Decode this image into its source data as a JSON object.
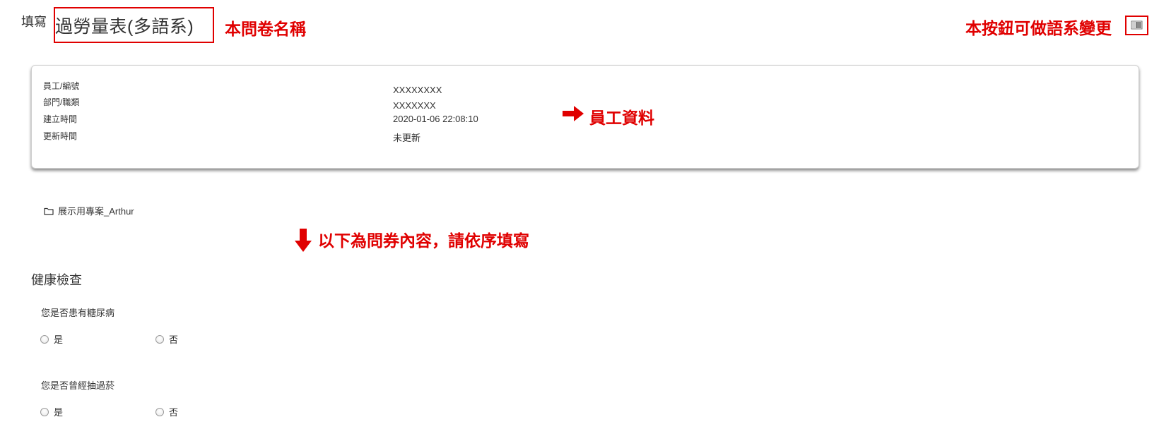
{
  "header": {
    "prefix": "填寫",
    "survey_title": "過勞量表(多語系)"
  },
  "annotations": {
    "title_note": "本問卷名稱",
    "language_note": "本按鈕可做語系變更",
    "employee_note": "員工資料",
    "content_note": "以下為問券內容，請依序填寫"
  },
  "language_button": {
    "icon": "flag-icon"
  },
  "employee": {
    "rows": [
      {
        "label": "員工/編號",
        "value": "XXXXXXXX"
      },
      {
        "label": "部門/職類",
        "value": "XXXXXXX"
      },
      {
        "label": "建立時間",
        "value": "2020-01-06 22:08:10"
      },
      {
        "label": "更新時間",
        "value": "未更新"
      }
    ]
  },
  "project": {
    "icon": "folder-icon",
    "name": "展示用專案_Arthur"
  },
  "section": {
    "title": "健康檢查",
    "questions": [
      {
        "text": "您是否患有糖尿病",
        "options": [
          "是",
          "否"
        ]
      },
      {
        "text": "您是否曾經抽過菸",
        "options": [
          "是",
          "否"
        ]
      }
    ]
  },
  "colors": {
    "annotation": "#e00000",
    "text": "#333333"
  }
}
